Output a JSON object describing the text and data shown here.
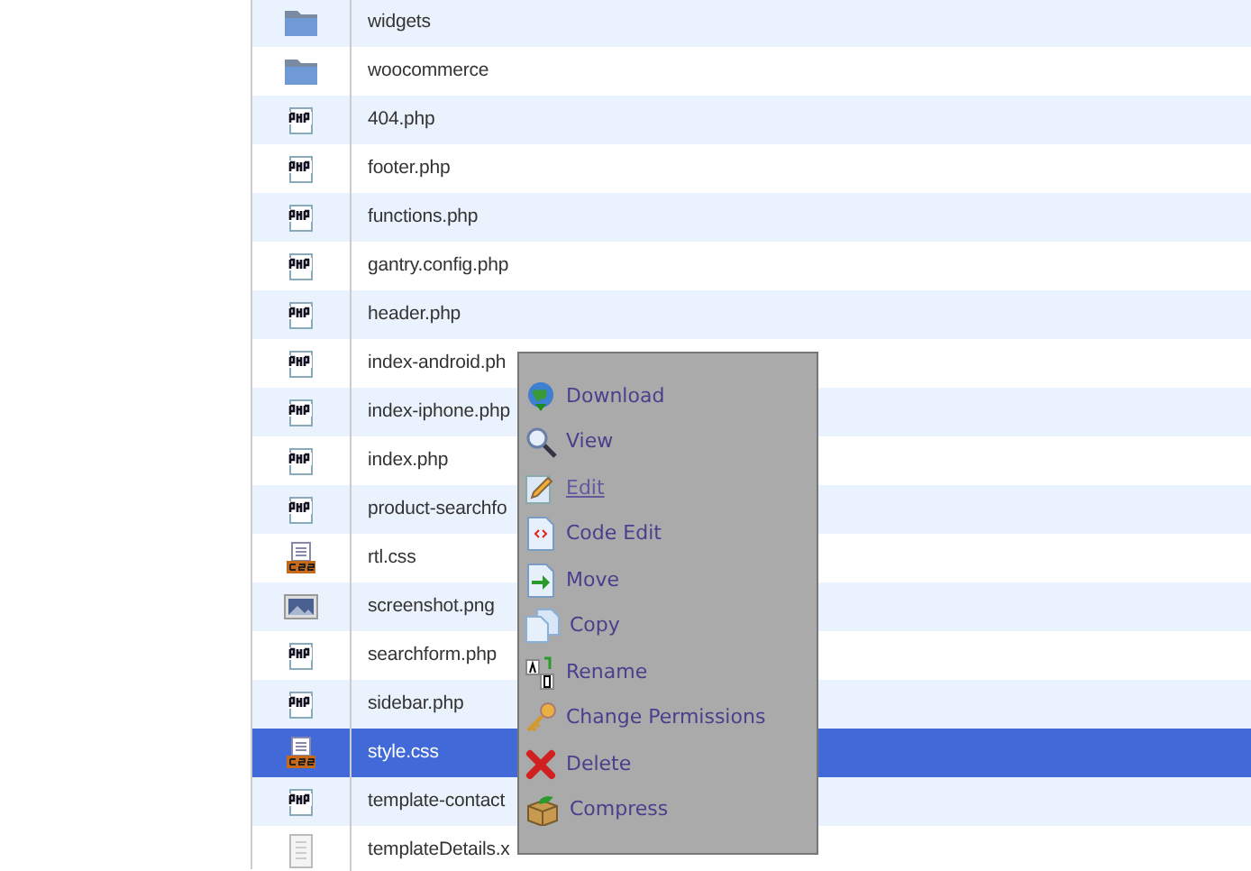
{
  "files": [
    {
      "name": "widgets",
      "kind": "folder",
      "selected": false
    },
    {
      "name": "woocommerce",
      "kind": "folder",
      "selected": false
    },
    {
      "name": "404.php",
      "kind": "php",
      "selected": false
    },
    {
      "name": "footer.php",
      "kind": "php",
      "selected": false
    },
    {
      "name": "functions.php",
      "kind": "php",
      "selected": false
    },
    {
      "name": "gantry.config.php",
      "kind": "php",
      "selected": false
    },
    {
      "name": "header.php",
      "kind": "php",
      "selected": false
    },
    {
      "name": "index-android.ph",
      "kind": "php",
      "selected": false
    },
    {
      "name": "index-iphone.php",
      "kind": "php",
      "selected": false
    },
    {
      "name": "index.php",
      "kind": "php",
      "selected": false
    },
    {
      "name": "product-searchfo",
      "kind": "php",
      "selected": false
    },
    {
      "name": "rtl.css",
      "kind": "css",
      "selected": false
    },
    {
      "name": "screenshot.png",
      "kind": "image",
      "selected": false
    },
    {
      "name": "searchform.php",
      "kind": "php",
      "selected": false
    },
    {
      "name": "sidebar.php",
      "kind": "php",
      "selected": false
    },
    {
      "name": "style.css",
      "kind": "css",
      "selected": true
    },
    {
      "name": "template-contact",
      "kind": "php",
      "selected": false
    },
    {
      "name": "templateDetails.x",
      "kind": "doc",
      "selected": false
    }
  ],
  "context_menu": {
    "items": [
      {
        "label": "Download",
        "kind": "download",
        "disabled": false
      },
      {
        "label": "View",
        "kind": "view",
        "disabled": false
      },
      {
        "label": "Edit",
        "kind": "edit",
        "disabled": true
      },
      {
        "label": "Code Edit",
        "kind": "code",
        "disabled": false
      },
      {
        "label": "Move",
        "kind": "move",
        "disabled": false
      },
      {
        "label": "Copy",
        "kind": "copy",
        "disabled": false
      },
      {
        "label": "Rename",
        "kind": "rename",
        "disabled": false
      },
      {
        "label": "Change Permissions",
        "kind": "permissions",
        "disabled": false
      },
      {
        "label": "Delete",
        "kind": "delete",
        "disabled": false
      },
      {
        "label": "Compress",
        "kind": "compress",
        "disabled": false
      }
    ]
  }
}
